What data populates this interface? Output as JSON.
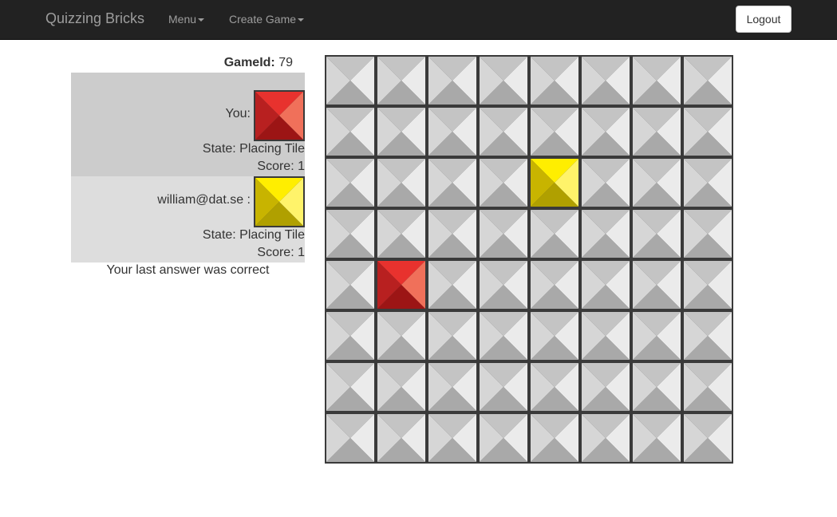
{
  "navbar": {
    "brand": "Quizzing Bricks",
    "menu_label": "Menu",
    "create_game_label": "Create Game",
    "logout_label": "Logout"
  },
  "game": {
    "id_label": "GameId:",
    "id_value": "79"
  },
  "players": [
    {
      "name": "You:",
      "color": "red",
      "state": "State: Placing Tile",
      "score": "Score: 1"
    },
    {
      "name": "william@dat.se :",
      "color": "yellow",
      "state": "State: Placing Tile",
      "score": "Score: 1"
    }
  ],
  "status_message": "Your last answer was correct",
  "board": {
    "rows": 8,
    "cols": 8,
    "placed_tiles": [
      {
        "row": 2,
        "col": 4,
        "color": "yellow"
      },
      {
        "row": 4,
        "col": 1,
        "color": "red"
      }
    ]
  },
  "colors": {
    "navbar_bg": "#222222",
    "player1_panel": "#cccccc",
    "player2_panel": "#dddddd",
    "tile_grey": [
      "#c4c4c4",
      "#ebebeb",
      "#a9a9a9",
      "#d6d6d6"
    ],
    "tile_red": [
      "#e8322e",
      "#f0705a",
      "#9c1515",
      "#b82020"
    ],
    "tile_yellow": [
      "#ffee00",
      "#fff36a",
      "#b0a000",
      "#c8b400"
    ]
  }
}
